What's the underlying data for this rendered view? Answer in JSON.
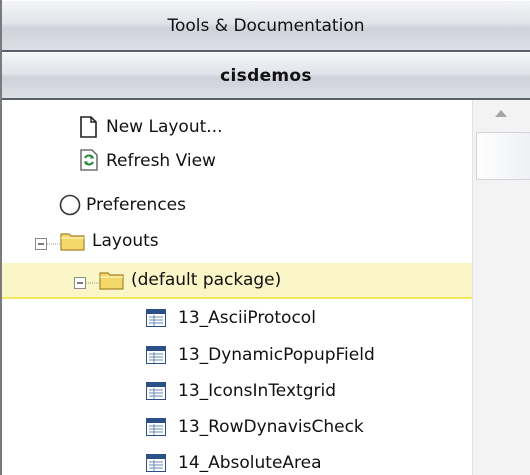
{
  "header": {
    "title": "Tools & Documentation"
  },
  "project": {
    "name": "cisdemos"
  },
  "tree": {
    "new_layout": "New Layout...",
    "refresh_view": "Refresh View",
    "preferences": "Preferences",
    "layouts": "Layouts",
    "default_package": "(default package)",
    "items": [
      "13_AsciiProtocol",
      "13_DynamicPopupField",
      "13_IconsInTextgrid",
      "13_RowDynavisCheck",
      "14_AbsoluteArea"
    ]
  },
  "colors": {
    "selection_bg": "#fbf6c7",
    "selection_border": "#f6e65e",
    "folder": "#f5d86a"
  }
}
